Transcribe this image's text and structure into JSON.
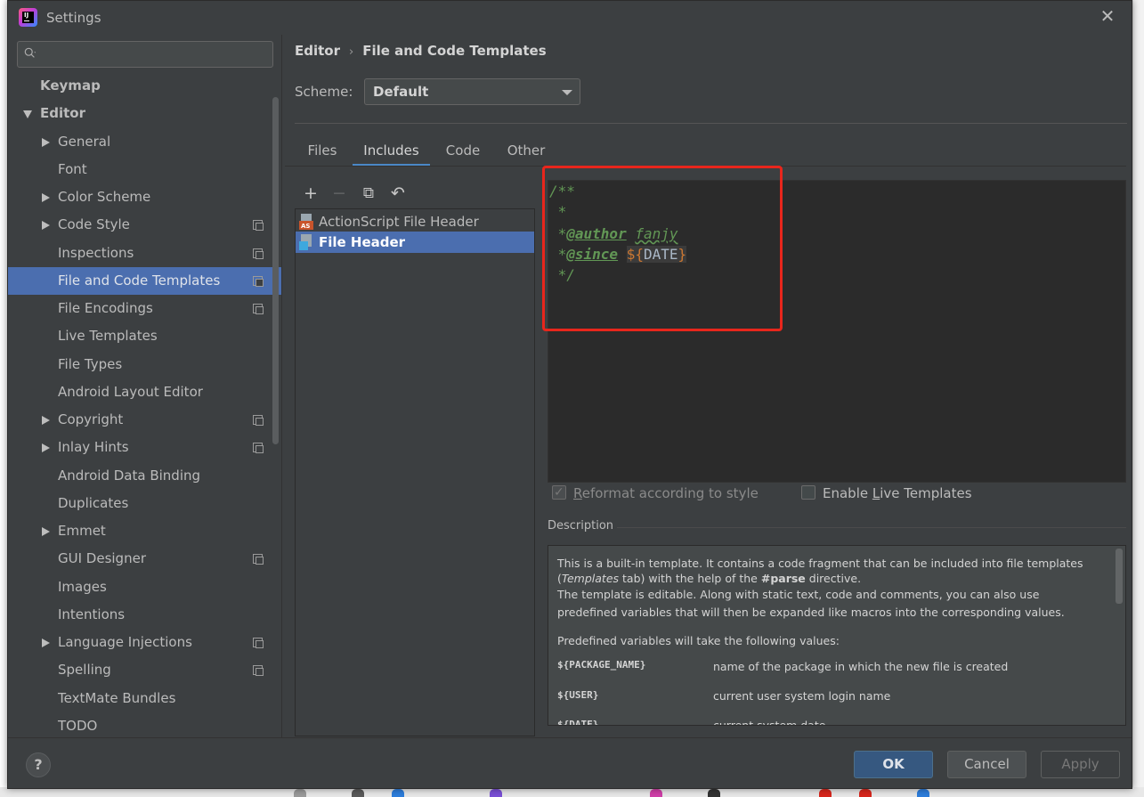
{
  "window": {
    "title": "Settings"
  },
  "search": {
    "placeholder": ""
  },
  "sidebar": {
    "items": [
      {
        "label": "Keymap",
        "indent": 0,
        "arrow": "none",
        "bold": true,
        "project": false
      },
      {
        "label": "Editor",
        "indent": 0,
        "arrow": "down",
        "bold": true,
        "project": false
      },
      {
        "label": "General",
        "indent": 1,
        "arrow": "right",
        "project": false
      },
      {
        "label": "Font",
        "indent": 1,
        "arrow": "none",
        "project": false
      },
      {
        "label": "Color Scheme",
        "indent": 1,
        "arrow": "right",
        "project": false
      },
      {
        "label": "Code Style",
        "indent": 1,
        "arrow": "right",
        "project": true
      },
      {
        "label": "Inspections",
        "indent": 1,
        "arrow": "none",
        "project": true
      },
      {
        "label": "File and Code Templates",
        "indent": 1,
        "arrow": "none",
        "project": true,
        "selected": true
      },
      {
        "label": "File Encodings",
        "indent": 1,
        "arrow": "none",
        "project": true
      },
      {
        "label": "Live Templates",
        "indent": 1,
        "arrow": "none",
        "project": false
      },
      {
        "label": "File Types",
        "indent": 1,
        "arrow": "none",
        "project": false
      },
      {
        "label": "Android Layout Editor",
        "indent": 1,
        "arrow": "none",
        "project": false
      },
      {
        "label": "Copyright",
        "indent": 1,
        "arrow": "right",
        "project": true
      },
      {
        "label": "Inlay Hints",
        "indent": 1,
        "arrow": "right",
        "project": true
      },
      {
        "label": "Android Data Binding",
        "indent": 1,
        "arrow": "none",
        "project": false
      },
      {
        "label": "Duplicates",
        "indent": 1,
        "arrow": "none",
        "project": false
      },
      {
        "label": "Emmet",
        "indent": 1,
        "arrow": "right",
        "project": false
      },
      {
        "label": "GUI Designer",
        "indent": 1,
        "arrow": "none",
        "project": true
      },
      {
        "label": "Images",
        "indent": 1,
        "arrow": "none",
        "project": false
      },
      {
        "label": "Intentions",
        "indent": 1,
        "arrow": "none",
        "project": false
      },
      {
        "label": "Language Injections",
        "indent": 1,
        "arrow": "right",
        "project": true
      },
      {
        "label": "Spelling",
        "indent": 1,
        "arrow": "none",
        "project": true
      },
      {
        "label": "TextMate Bundles",
        "indent": 1,
        "arrow": "none",
        "project": false
      },
      {
        "label": "TODO",
        "indent": 1,
        "arrow": "none",
        "project": false
      }
    ]
  },
  "breadcrumb": {
    "parent": "Editor",
    "separator": "›",
    "current": "File and Code Templates"
  },
  "scheme": {
    "label": "Scheme:",
    "value": "Default"
  },
  "tabs": [
    {
      "label": "Files",
      "active": false
    },
    {
      "label": "Includes",
      "active": true
    },
    {
      "label": "Code",
      "active": false
    },
    {
      "label": "Other",
      "active": false
    }
  ],
  "toolbar": {
    "add": "+",
    "remove": "−",
    "copy": "⧉",
    "reset": "↶"
  },
  "templates": [
    {
      "label": "ActionScript File Header",
      "icon": "actionscript-file-icon",
      "selected": false
    },
    {
      "label": "File Header",
      "icon": "java-file-icon",
      "selected": true
    }
  ],
  "editor": {
    "line1": "/**",
    "line2": " *",
    "line3_prefix": " *",
    "line3_tag": "@author",
    "line3_value": "fanjy",
    "line4_prefix": " *",
    "line4_tag": "@since",
    "line4_dollar": "${",
    "line4_var": "DATE",
    "line4_close": "}",
    "line5": " */"
  },
  "options": {
    "reformat_label_pre": "R",
    "reformat_label_post": "eformat according to style",
    "reformat_checked": true,
    "live_label_pre": "Enable ",
    "live_label_ul": "L",
    "live_label_post": "ive Templates",
    "live_checked": false
  },
  "description": {
    "title": "Description",
    "p1_l1": "This is a built-in template. It contains a code fragment that can be included into file templates",
    "p1_l2_pre": "(",
    "p1_l2_em": "Templates",
    "p1_l2_mid": " tab) with the help of the ",
    "p1_l2_strong": "#parse",
    "p1_l2_post": " directive.",
    "p1_l3": "The template is editable. Along with static text, code and comments, you can also use",
    "p1_l4": "predefined variables that will then be expanded like macros into the corresponding values.",
    "p2": "Predefined variables will take the following values:",
    "vars": [
      {
        "name": "${PACKAGE_NAME}",
        "desc": "name of the package in which the new file is created"
      },
      {
        "name": "${USER}",
        "desc": "current user system login name"
      },
      {
        "name": "${DATE}",
        "desc": "current system date"
      }
    ]
  },
  "footer": {
    "help": "?",
    "ok": "OK",
    "cancel": "Cancel",
    "apply": "Apply"
  },
  "colors": {
    "accent": "#4b6eaf",
    "highlight_box": "#e8261c",
    "comment": "#629755",
    "ok_button": "#365880"
  }
}
